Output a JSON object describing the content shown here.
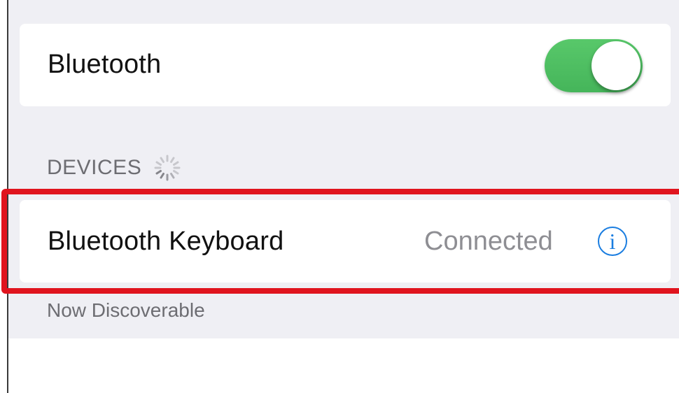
{
  "bluetooth": {
    "label": "Bluetooth",
    "enabled": true,
    "toggle_color": "#4cd964"
  },
  "devices_section": {
    "title": "DEVICES",
    "searching": true,
    "spinner_icon": "activity-spinner-icon"
  },
  "devices": [
    {
      "name": "Bluetooth Keyboard",
      "status": "Connected",
      "info_icon": "info-icon",
      "highlighted": true
    }
  ],
  "footer": {
    "text": "Now Discoverable"
  },
  "colors": {
    "background": "#efeff4",
    "accent": "#1a7de0",
    "highlight": "#e0141e",
    "secondary_text": "#8e8e93"
  }
}
